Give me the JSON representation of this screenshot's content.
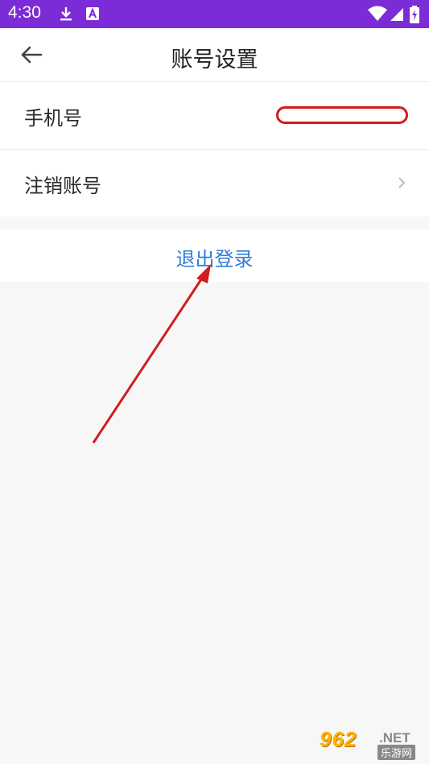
{
  "status_bar": {
    "time": "4:30",
    "icons": [
      "download-icon",
      "a-notification-icon",
      "wifi-icon",
      "cellular-icon",
      "battery-charging-icon"
    ]
  },
  "app_bar": {
    "title": "账号设置",
    "back_icon": "arrow-left-icon"
  },
  "settings": {
    "items": [
      {
        "label": "手机号",
        "value": ""
      },
      {
        "label": "注销账号",
        "icon": "chevron-right-icon"
      }
    ]
  },
  "logout": {
    "label": "退出登录"
  },
  "colors": {
    "status_bar": "#7b2cd6",
    "accent": "#2f7ed8",
    "annotation": "#d11c1c",
    "background": "#f7f7f7"
  },
  "watermark": {
    "main": "962",
    "suffix": ".NET",
    "sub": "乐游网"
  }
}
